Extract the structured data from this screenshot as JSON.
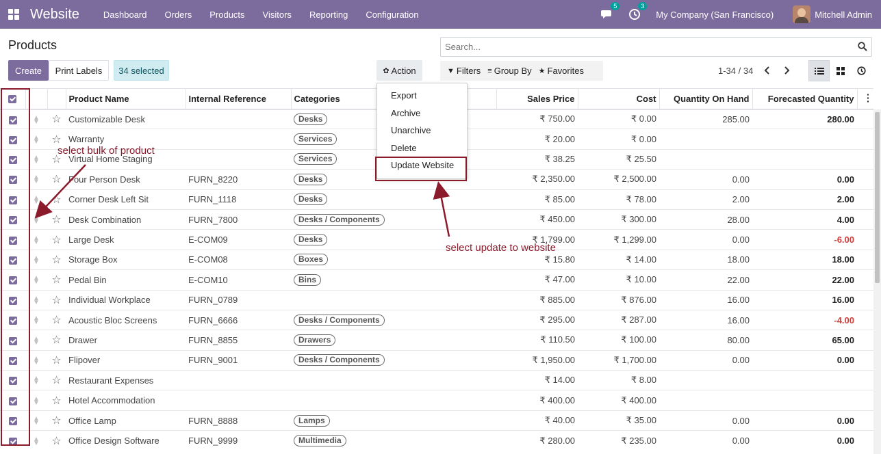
{
  "app": {
    "brand": "Website",
    "menu": [
      "Dashboard",
      "Orders",
      "Products",
      "Visitors",
      "Reporting",
      "Configuration"
    ],
    "messages_count": "5",
    "activities_count": "3",
    "company": "My Company (San Francisco)",
    "user": "Mitchell Admin"
  },
  "page": {
    "title": "Products",
    "create_label": "Create",
    "print_labels": "Print Labels",
    "selected_text": "34 selected",
    "action_label": "Action",
    "search_placeholder": "Search...",
    "filters_label": "Filters",
    "groupby_label": "Group By",
    "favorites_label": "Favorites",
    "pager": "1-34 / 34"
  },
  "action_menu": {
    "items": [
      "Export",
      "Archive",
      "Unarchive",
      "Delete",
      "Update Website"
    ]
  },
  "table": {
    "columns": [
      "Product Name",
      "Internal Reference",
      "Categories",
      "Sales Price",
      "Cost",
      "Quantity On Hand",
      "Forecasted Quantity"
    ],
    "rows": [
      {
        "name": "Customizable Desk",
        "ref": "",
        "cat": "Desks",
        "price": "₹ 750.00",
        "cost": "₹ 0.00",
        "qty": "285.00",
        "fc": "280.00",
        "neg": false
      },
      {
        "name": "Warranty",
        "ref": "",
        "cat": "Services",
        "price": "₹ 20.00",
        "cost": "₹ 0.00",
        "qty": "",
        "fc": "",
        "neg": false
      },
      {
        "name": "Virtual Home Staging",
        "ref": "",
        "cat": "Services",
        "price": "₹ 38.25",
        "cost": "₹ 25.50",
        "qty": "",
        "fc": "",
        "neg": false
      },
      {
        "name": "Four Person Desk",
        "ref": "FURN_8220",
        "cat": "Desks",
        "price": "₹ 2,350.00",
        "cost": "₹ 2,500.00",
        "qty": "0.00",
        "fc": "0.00",
        "neg": false
      },
      {
        "name": "Corner Desk Left Sit",
        "ref": "FURN_1118",
        "cat": "Desks",
        "price": "₹ 85.00",
        "cost": "₹ 78.00",
        "qty": "2.00",
        "fc": "2.00",
        "neg": false
      },
      {
        "name": "Desk Combination",
        "ref": "FURN_7800",
        "cat": "Desks / Components",
        "price": "₹ 450.00",
        "cost": "₹ 300.00",
        "qty": "28.00",
        "fc": "4.00",
        "neg": false
      },
      {
        "name": "Large Desk",
        "ref": "E-COM09",
        "cat": "Desks",
        "price": "₹ 1,799.00",
        "cost": "₹ 1,299.00",
        "qty": "0.00",
        "fc": "-6.00",
        "neg": true
      },
      {
        "name": "Storage Box",
        "ref": "E-COM08",
        "cat": "Boxes",
        "price": "₹ 15.80",
        "cost": "₹ 14.00",
        "qty": "18.00",
        "fc": "18.00",
        "neg": false
      },
      {
        "name": "Pedal Bin",
        "ref": "E-COM10",
        "cat": "Bins",
        "price": "₹ 47.00",
        "cost": "₹ 10.00",
        "qty": "22.00",
        "fc": "22.00",
        "neg": false
      },
      {
        "name": "Individual Workplace",
        "ref": "FURN_0789",
        "cat": "",
        "price": "₹ 885.00",
        "cost": "₹ 876.00",
        "qty": "16.00",
        "fc": "16.00",
        "neg": false
      },
      {
        "name": "Acoustic Bloc Screens",
        "ref": "FURN_6666",
        "cat": "Desks / Components",
        "price": "₹ 295.00",
        "cost": "₹ 287.00",
        "qty": "16.00",
        "fc": "-4.00",
        "neg": true
      },
      {
        "name": "Drawer",
        "ref": "FURN_8855",
        "cat": "Drawers",
        "price": "₹ 110.50",
        "cost": "₹ 100.00",
        "qty": "80.00",
        "fc": "65.00",
        "neg": false
      },
      {
        "name": "Flipover",
        "ref": "FURN_9001",
        "cat": "Desks / Components",
        "price": "₹ 1,950.00",
        "cost": "₹ 1,700.00",
        "qty": "0.00",
        "fc": "0.00",
        "neg": false
      },
      {
        "name": "Restaurant Expenses",
        "ref": "",
        "cat": "",
        "price": "₹ 14.00",
        "cost": "₹ 8.00",
        "qty": "",
        "fc": "",
        "neg": false
      },
      {
        "name": "Hotel Accommodation",
        "ref": "",
        "cat": "",
        "price": "₹ 400.00",
        "cost": "₹ 400.00",
        "qty": "",
        "fc": "",
        "neg": false
      },
      {
        "name": "Office Lamp",
        "ref": "FURN_8888",
        "cat": "Lamps",
        "price": "₹ 40.00",
        "cost": "₹ 35.00",
        "qty": "0.00",
        "fc": "0.00",
        "neg": false
      },
      {
        "name": "Office Design Software",
        "ref": "FURN_9999",
        "cat": "Multimedia",
        "price": "₹ 280.00",
        "cost": "₹ 235.00",
        "qty": "0.00",
        "fc": "0.00",
        "neg": false
      }
    ]
  },
  "annotations": {
    "left_note": "select bulk of product",
    "right_note": "select update to website",
    "color": "#8b1a2b"
  },
  "theme": {
    "primary": "#7c6b9d",
    "badge": "#00a09d",
    "negative": "#d23f3a"
  }
}
